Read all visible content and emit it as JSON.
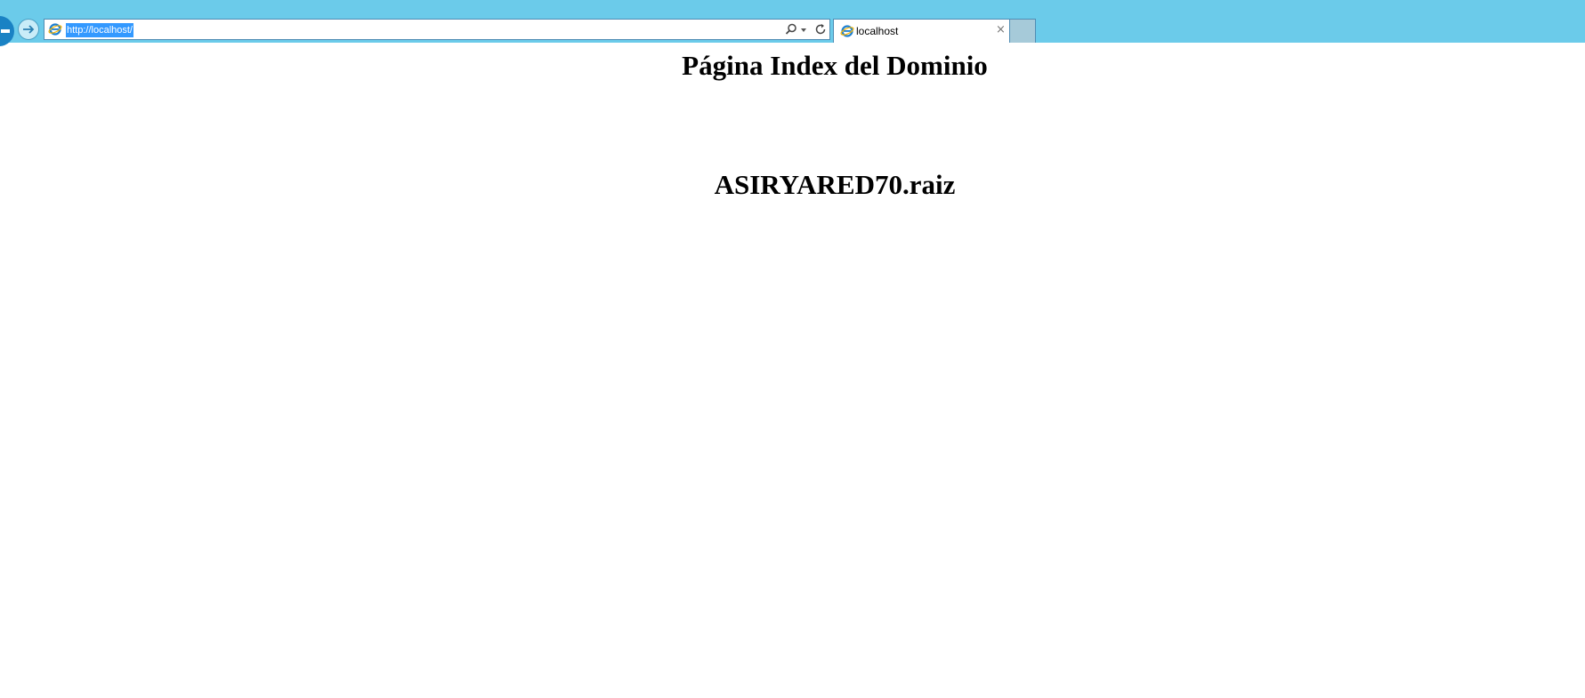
{
  "browser": {
    "address_url": "http://localhost/",
    "tab_title": "localhost",
    "tab_close": "×"
  },
  "page": {
    "heading": "Página Index del Dominio",
    "domain": "ASIRYARED70.raiz"
  },
  "colors": {
    "toolbar": "#6bcbea",
    "url_selection": "#3399ff"
  }
}
